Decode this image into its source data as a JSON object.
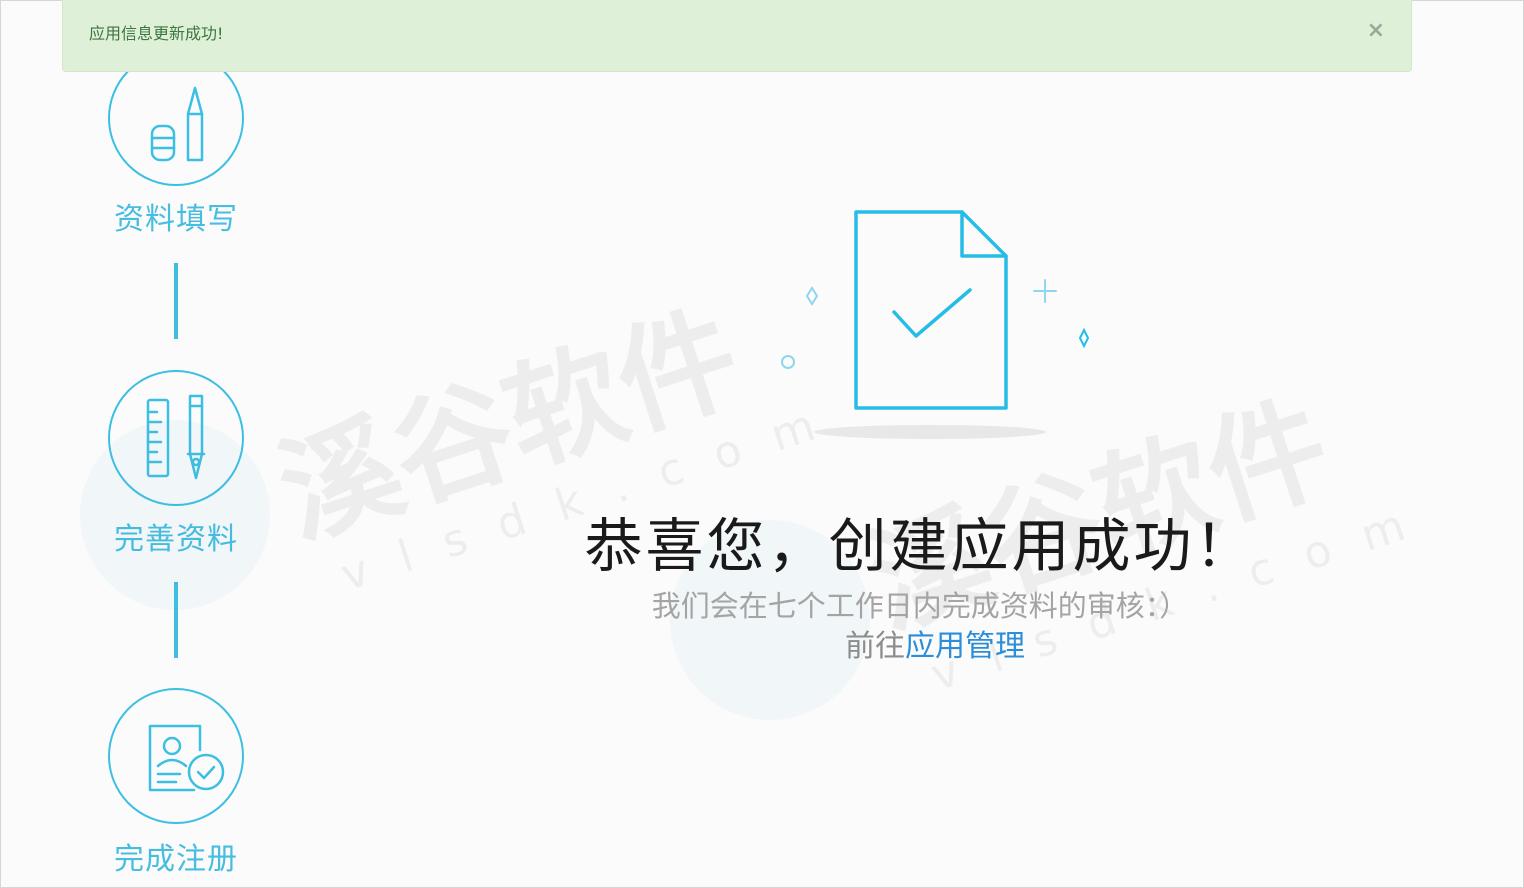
{
  "alert": {
    "message": "应用信息更新成功!",
    "close_symbol": "×",
    "close_icon": "close-icon"
  },
  "steps": [
    {
      "label": "资料填写",
      "icon": "pencil-eraser-icon"
    },
    {
      "label": "完善资料",
      "icon": "ruler-pen-icon"
    },
    {
      "label": "完成注册",
      "icon": "id-card-check-icon"
    }
  ],
  "result": {
    "illustration_icon": "document-check-icon",
    "title": "恭喜您，创建应用成功！",
    "subtitle": "我们会在七个工作日内完成资料的审核：）",
    "goto_prefix": "前往",
    "goto_link_label": "应用管理"
  },
  "watermark": {
    "text": "溪谷软件",
    "sub": "vlsdk.com"
  },
  "colors": {
    "accent": "#3dbfe3",
    "step_text": "#47bde0",
    "alert_bg": "#dff0d8",
    "alert_text": "#3c763d",
    "link": "#2d8ed8",
    "title": "#1a1a1a",
    "subtitle": "#a4a4a4"
  }
}
